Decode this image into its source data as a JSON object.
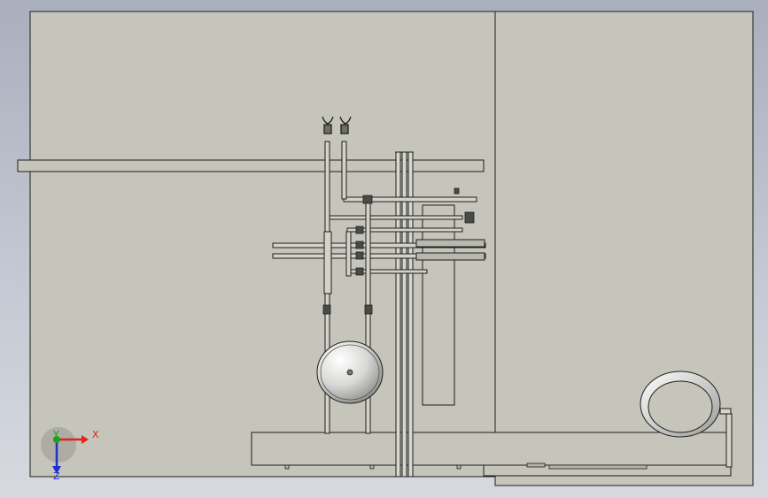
{
  "viewport": {
    "background_top": "#a9afbd",
    "background_bottom": "#d6d9df",
    "model_fill": "#c6c5bb",
    "edge_color": "#1e1e1e"
  },
  "triad": {
    "x_label": "X",
    "y_label": "Y",
    "z_label": "Z",
    "x_color": "#e0241b",
    "y_color": "#1aa31a",
    "z_color": "#1f2fd0"
  }
}
